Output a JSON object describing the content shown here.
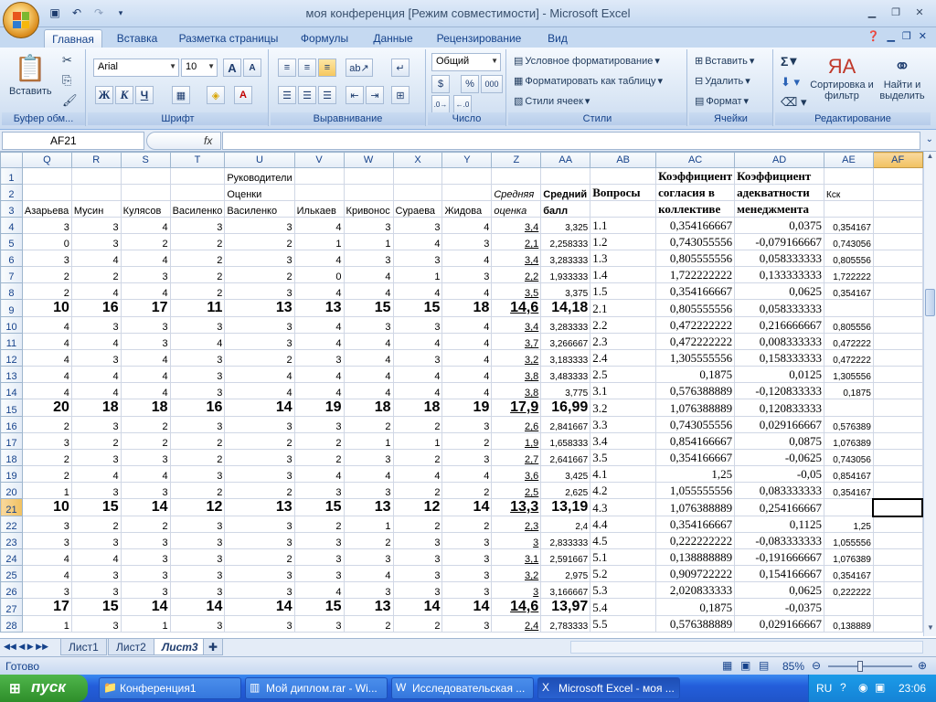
{
  "window": {
    "title": "моя конференция  [Режим совместимости] - Microsoft Excel"
  },
  "tabs": [
    "Главная",
    "Вставка",
    "Разметка страницы",
    "Формулы",
    "Данные",
    "Рецензирование",
    "Вид"
  ],
  "ribbon": {
    "clipboard": {
      "title": "Буфер обм...",
      "paste": "Вставить"
    },
    "font": {
      "title": "Шрифт",
      "name": "Arial",
      "size": "10",
      "bold": "Ж",
      "italic": "К",
      "underline": "Ч",
      "grow": "A",
      "shrink": "A"
    },
    "align": {
      "title": "Выравнивание"
    },
    "number": {
      "title": "Число",
      "format": "Общий",
      "percent": "%",
      "thousands": "000",
      "currency": "$"
    },
    "styles": {
      "title": "Стили",
      "cond": "Условное форматирование",
      "table": "Форматировать как таблицу",
      "cell": "Стили ячеек"
    },
    "cells": {
      "title": "Ячейки",
      "insert": "Вставить",
      "delete": "Удалить",
      "format": "Формат"
    },
    "editing": {
      "title": "Редактирование",
      "sort": "Сортировка и фильтр",
      "find": "Найти и выделить",
      "sigma": "Σ"
    }
  },
  "formula_bar": {
    "name_box": "AF21",
    "fx": "fx",
    "value": ""
  },
  "columns": [
    "Q",
    "R",
    "S",
    "T",
    "U",
    "V",
    "W",
    "X",
    "Y",
    "Z",
    "AA",
    "AB",
    "AC",
    "AD",
    "AE",
    "AF"
  ],
  "rows": [
    {
      "n": "1",
      "c": [
        "",
        "",
        "",
        "",
        "Руководители",
        "",
        "",
        "",
        "",
        "",
        "",
        "",
        "Коэффициент",
        "Коэффициент",
        "",
        ""
      ]
    },
    {
      "n": "2",
      "c": [
        "",
        "",
        "",
        "",
        "Оценки",
        "",
        "",
        "",
        "",
        "Средняя",
        "Средний",
        "Вопросы",
        "согласия в",
        "адекватности",
        "Кск",
        ""
      ]
    },
    {
      "n": "3",
      "c": [
        "Азарьева",
        "Мусин",
        "Кулясов",
        "Василенко",
        "Василенко",
        "Илькаев",
        "Кривонос",
        "Сураева",
        "Жидова",
        "оценка",
        "балл",
        "",
        "коллективе",
        "менеджмента",
        "",
        ""
      ]
    },
    {
      "n": "4",
      "c": [
        "3",
        "3",
        "4",
        "3",
        "3",
        "4",
        "3",
        "3",
        "4",
        "3,4",
        "3,325",
        "1.1",
        "0,354166667",
        "0,0375",
        "0,354167",
        ""
      ]
    },
    {
      "n": "5",
      "c": [
        "0",
        "3",
        "2",
        "2",
        "2",
        "1",
        "1",
        "4",
        "3",
        "2,1",
        "2,258333",
        "1.2",
        "0,743055556",
        "-0,079166667",
        "0,743056",
        ""
      ]
    },
    {
      "n": "6",
      "c": [
        "3",
        "4",
        "4",
        "2",
        "3",
        "4",
        "3",
        "3",
        "4",
        "3,4",
        "3,283333",
        "1.3",
        "0,805555556",
        "0,058333333",
        "0,805556",
        ""
      ]
    },
    {
      "n": "7",
      "c": [
        "2",
        "2",
        "3",
        "2",
        "2",
        "0",
        "4",
        "1",
        "3",
        "2,2",
        "1,933333",
        "1.4",
        "1,722222222",
        "0,133333333",
        "1,722222",
        ""
      ]
    },
    {
      "n": "8",
      "c": [
        "2",
        "4",
        "4",
        "2",
        "3",
        "4",
        "4",
        "4",
        "4",
        "3,5",
        "3,375",
        "1.5",
        "0,354166667",
        "0,0625",
        "0,354167",
        ""
      ]
    },
    {
      "n": "9",
      "c": [
        "10",
        "16",
        "17",
        "11",
        "13",
        "13",
        "15",
        "15",
        "18",
        "14,6",
        "14,18",
        "2.1",
        "0,805555556",
        "0,058333333",
        "",
        ""
      ]
    },
    {
      "n": "10",
      "c": [
        "4",
        "3",
        "3",
        "3",
        "3",
        "4",
        "3",
        "3",
        "4",
        "3,4",
        "3,283333",
        "2.2",
        "0,472222222",
        "0,216666667",
        "0,805556",
        ""
      ]
    },
    {
      "n": "11",
      "c": [
        "4",
        "4",
        "3",
        "4",
        "3",
        "4",
        "4",
        "4",
        "4",
        "3,7",
        "3,266667",
        "2.3",
        "0,472222222",
        "0,008333333",
        "0,472222",
        ""
      ]
    },
    {
      "n": "12",
      "c": [
        "4",
        "3",
        "4",
        "3",
        "2",
        "3",
        "4",
        "3",
        "4",
        "3,2",
        "3,183333",
        "2.4",
        "1,305555556",
        "0,158333333",
        "0,472222",
        ""
      ]
    },
    {
      "n": "13",
      "c": [
        "4",
        "4",
        "4",
        "3",
        "4",
        "4",
        "4",
        "4",
        "4",
        "3,8",
        "3,483333",
        "2.5",
        "0,1875",
        "0,0125",
        "1,305556",
        ""
      ]
    },
    {
      "n": "14",
      "c": [
        "4",
        "4",
        "4",
        "3",
        "4",
        "4",
        "4",
        "4",
        "4",
        "3,8",
        "3,775",
        "3.1",
        "0,576388889",
        "-0,120833333",
        "0,1875",
        ""
      ]
    },
    {
      "n": "15",
      "c": [
        "20",
        "18",
        "18",
        "16",
        "14",
        "19",
        "18",
        "18",
        "19",
        "17,9",
        "16,99",
        "3.2",
        "1,076388889",
        "0,120833333",
        "",
        ""
      ]
    },
    {
      "n": "16",
      "c": [
        "2",
        "3",
        "2",
        "3",
        "3",
        "3",
        "2",
        "2",
        "3",
        "2,6",
        "2,841667",
        "3.3",
        "0,743055556",
        "0,029166667",
        "0,576389",
        ""
      ]
    },
    {
      "n": "17",
      "c": [
        "3",
        "2",
        "2",
        "2",
        "2",
        "2",
        "1",
        "1",
        "2",
        "1,9",
        "1,658333",
        "3.4",
        "0,854166667",
        "0,0875",
        "1,076389",
        ""
      ]
    },
    {
      "n": "18",
      "c": [
        "2",
        "3",
        "3",
        "2",
        "3",
        "2",
        "3",
        "2",
        "3",
        "2,7",
        "2,641667",
        "3.5",
        "0,354166667",
        "-0,0625",
        "0,743056",
        ""
      ]
    },
    {
      "n": "19",
      "c": [
        "2",
        "4",
        "4",
        "3",
        "3",
        "4",
        "4",
        "4",
        "4",
        "3,6",
        "3,425",
        "4.1",
        "1,25",
        "-0,05",
        "0,854167",
        ""
      ]
    },
    {
      "n": "20",
      "c": [
        "1",
        "3",
        "3",
        "2",
        "2",
        "3",
        "3",
        "2",
        "2",
        "2,5",
        "2,625",
        "4.2",
        "1,055555556",
        "0,083333333",
        "0,354167",
        ""
      ]
    },
    {
      "n": "21",
      "c": [
        "10",
        "15",
        "14",
        "12",
        "13",
        "15",
        "13",
        "12",
        "14",
        "13,3",
        "13,19",
        "4.3",
        "1,076388889",
        "0,254166667",
        "",
        ""
      ]
    },
    {
      "n": "22",
      "c": [
        "3",
        "2",
        "2",
        "3",
        "3",
        "2",
        "1",
        "2",
        "2",
        "2,3",
        "2,4",
        "4.4",
        "0,354166667",
        "0,1125",
        "1,25",
        ""
      ]
    },
    {
      "n": "23",
      "c": [
        "3",
        "3",
        "3",
        "3",
        "3",
        "3",
        "2",
        "3",
        "3",
        "3",
        "2,833333",
        "4.5",
        "0,222222222",
        "-0,083333333",
        "1,055556",
        ""
      ]
    },
    {
      "n": "24",
      "c": [
        "4",
        "4",
        "3",
        "3",
        "2",
        "3",
        "3",
        "3",
        "3",
        "3,1",
        "2,591667",
        "5.1",
        "0,138888889",
        "-0,191666667",
        "1,076389",
        ""
      ]
    },
    {
      "n": "25",
      "c": [
        "4",
        "3",
        "3",
        "3",
        "3",
        "3",
        "4",
        "3",
        "3",
        "3,2",
        "2,975",
        "5.2",
        "0,909722222",
        "0,154166667",
        "0,354167",
        ""
      ]
    },
    {
      "n": "26",
      "c": [
        "3",
        "3",
        "3",
        "3",
        "3",
        "4",
        "3",
        "3",
        "3",
        "3",
        "3,166667",
        "5.3",
        "2,020833333",
        "0,0625",
        "0,222222",
        ""
      ]
    },
    {
      "n": "27",
      "c": [
        "17",
        "15",
        "14",
        "14",
        "14",
        "15",
        "13",
        "14",
        "14",
        "14,6",
        "13,97",
        "5.4",
        "0,1875",
        "-0,0375",
        "",
        ""
      ]
    },
    {
      "n": "28",
      "c": [
        "1",
        "3",
        "1",
        "3",
        "3",
        "3",
        "2",
        "2",
        "3",
        "2,4",
        "2,783333",
        "5.5",
        "0,576388889",
        "0,029166667",
        "0,138889",
        ""
      ]
    }
  ],
  "sheets": [
    "Лист1",
    "Лист2",
    "Лист3"
  ],
  "status": {
    "ready": "Готово",
    "zoom": "85%"
  },
  "taskbar": {
    "start": "пуск",
    "tasks": [
      "Конференция1",
      "Мой диплом.rar - Wi...",
      "Исследовательская ...",
      "Microsoft Excel - моя ..."
    ],
    "lang": "RU",
    "time": "23:06"
  }
}
